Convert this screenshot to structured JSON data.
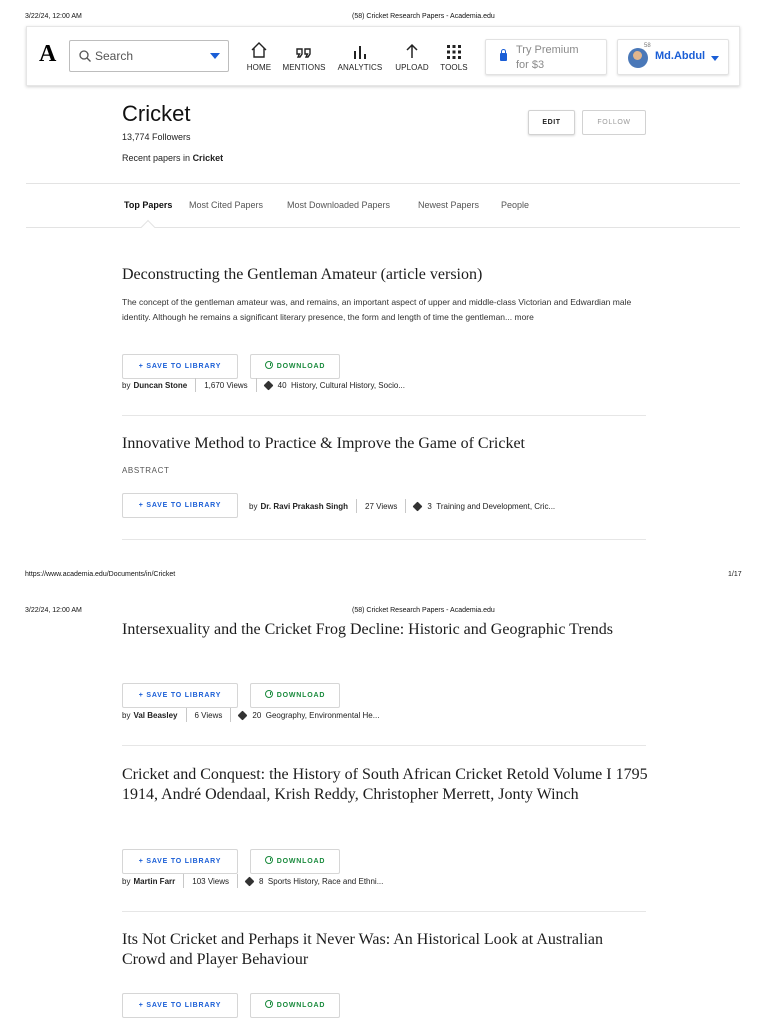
{
  "print_header": {
    "datetime": "3/22/24, 12:00 AM",
    "page_title": "(58) Cricket Research Papers - Academia.edu"
  },
  "print_footer": {
    "url": "https://www.academia.edu/Documents/in/Cricket",
    "page_number": "1/17"
  },
  "navbar": {
    "logo": "A",
    "search_placeholder": "Search",
    "items": [
      {
        "label": "HOME",
        "icon": "home-icon"
      },
      {
        "label": "MENTIONS",
        "icon": "quote-icon"
      },
      {
        "label": "ANALYTICS",
        "icon": "bar-chart-icon"
      },
      {
        "label": "UPLOAD",
        "icon": "upload-arrow-icon"
      },
      {
        "label": "TOOLS",
        "icon": "grid-icon"
      }
    ],
    "premium_line1": "Try Premium",
    "premium_line2": "for $3",
    "avatar_badge": "58",
    "username": "Md.Abdul"
  },
  "topic": {
    "title": "Cricket",
    "followers": "13,774 Followers",
    "recent_prefix": "Recent papers in",
    "recent_topic": "Cricket",
    "edit_label": "EDIT",
    "follow_label": "FOLLOW"
  },
  "tabs": [
    "Top Papers",
    "Most Cited Papers",
    "Most Downloaded Papers",
    "Newest Papers",
    "People"
  ],
  "buttons": {
    "save": "+ SAVE TO LIBRARY",
    "download": "DOWNLOAD"
  },
  "papers": [
    {
      "title": "Deconstructing the Gentleman Amateur (article version)",
      "abstract": "The concept of the gentleman amateur was, and remains, an important aspect of upper and middle-class Victorian and Edwardian male identity. Although he remains a significant literary presence, the form and length of time the gentleman...",
      "more": "more",
      "by": "by",
      "author": "Duncan Stone",
      "views": "1,670 Views",
      "tag_count": "40",
      "tags": "History, Cultural History, Socio..."
    },
    {
      "title": "Innovative Method to Practice & Improve the Game of Cricket",
      "abstract_label": "ABSTRACT",
      "by": "by",
      "author": "Dr. Ravi Prakash Singh",
      "views": "27 Views",
      "tag_count": "3",
      "tags": "Training and Development, Cric..."
    },
    {
      "title": "Intersexuality and the Cricket Frog Decline: Historic and Geographic Trends",
      "by": "by",
      "author": "Val Beasley",
      "views": "6 Views",
      "tag_count": "20",
      "tags": "Geography, Environmental He..."
    },
    {
      "title": "Cricket and Conquest: the History of South African Cricket Retold Volume I 1795 1914, André Odendaal, Krish Reddy, Christopher Merrett, Jonty Winch",
      "by": "by",
      "author": "Martin Farr",
      "views": "103 Views",
      "tag_count": "8",
      "tags": "Sports History, Race and Ethni..."
    },
    {
      "title": "Its Not Cricket and Perhaps it Never Was: An Historical Look at Australian Crowd and Player Behaviour"
    }
  ],
  "colors": {
    "brand_blue": "#1a5ed6",
    "download_green": "#198a3c"
  }
}
